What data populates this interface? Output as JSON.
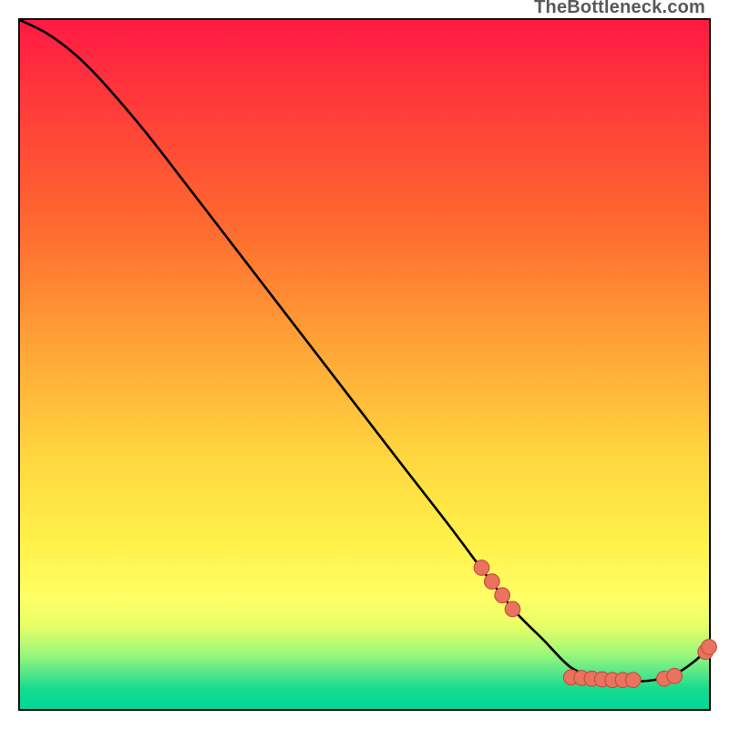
{
  "watermark": "TheBottleneck.com",
  "colors": {
    "curve_stroke": "#000000",
    "marker_fill": "#e9735f",
    "marker_stroke": "#c24e3c"
  },
  "chart_data": {
    "type": "line",
    "title": "",
    "xlabel": "",
    "ylabel": "",
    "xlim": [
      0,
      100
    ],
    "ylim": [
      0,
      100
    ],
    "grid": false,
    "legend": false,
    "series": [
      {
        "name": "bottleneck-curve",
        "x": [
          0,
          4,
          8,
          12,
          18,
          25,
          35,
          45,
          55,
          62,
          68,
          72,
          76,
          80,
          84,
          88,
          92,
          95,
          98,
          100
        ],
        "y": [
          100,
          98,
          95,
          91,
          84,
          75,
          62,
          49,
          36,
          27,
          19,
          14,
          10,
          6,
          4.5,
          4,
          4.2,
          5,
          7,
          9
        ]
      }
    ],
    "markers": [
      {
        "x": 67.0,
        "y": 20.5
      },
      {
        "x": 68.5,
        "y": 18.5
      },
      {
        "x": 70.0,
        "y": 16.5
      },
      {
        "x": 71.5,
        "y": 14.5
      },
      {
        "x": 80.0,
        "y": 4.6
      },
      {
        "x": 81.5,
        "y": 4.5
      },
      {
        "x": 83.0,
        "y": 4.4
      },
      {
        "x": 84.5,
        "y": 4.3
      },
      {
        "x": 86.0,
        "y": 4.2
      },
      {
        "x": 87.5,
        "y": 4.2
      },
      {
        "x": 89.0,
        "y": 4.2
      },
      {
        "x": 93.5,
        "y": 4.4
      },
      {
        "x": 95.0,
        "y": 4.8
      },
      {
        "x": 99.5,
        "y": 8.3
      },
      {
        "x": 100.0,
        "y": 9.0
      }
    ]
  }
}
